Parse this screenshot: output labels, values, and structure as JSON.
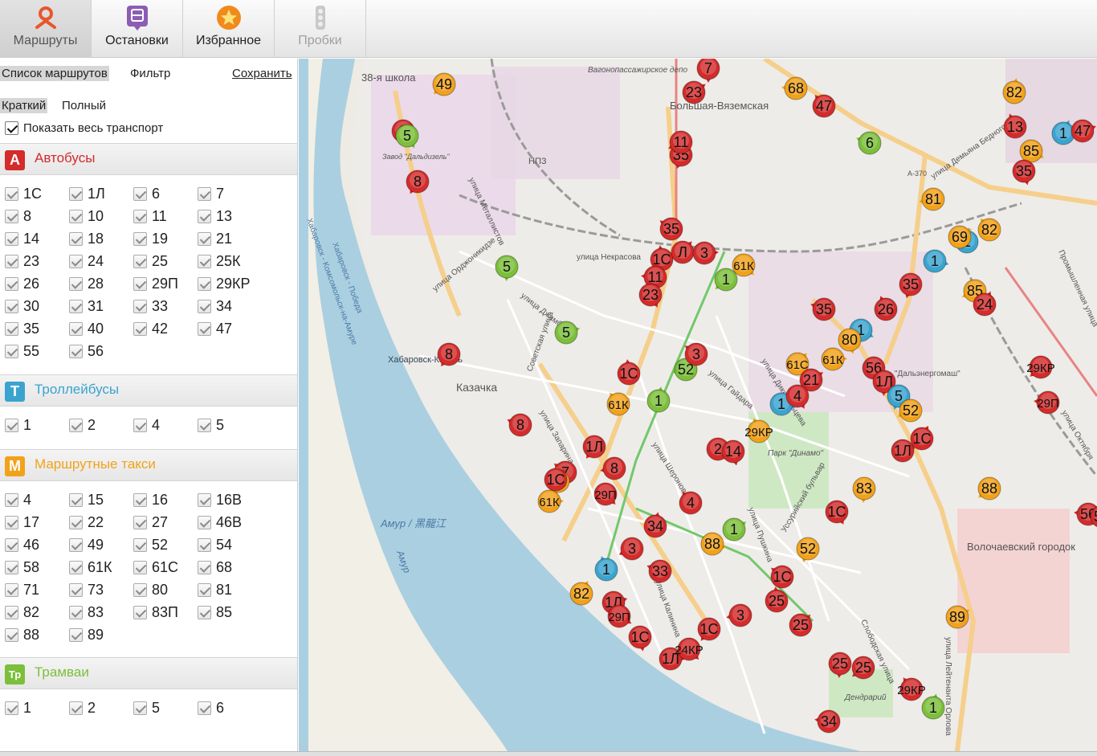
{
  "tabs": [
    {
      "label": "Маршруты",
      "icon": "route-pin-icon",
      "active": true
    },
    {
      "label": "Остановки",
      "icon": "bus-stop-icon"
    },
    {
      "label": "Избранное",
      "icon": "star-icon"
    },
    {
      "label": "Пробки",
      "icon": "traffic-light-icon",
      "disabled": true
    }
  ],
  "sidebar": {
    "list_tab": "Список маршрутов",
    "filter_tab": "Фильтр",
    "save_link": "Сохранить",
    "view_short": "Краткий",
    "view_full": "Полный",
    "show_all": "Показать весь транспорт"
  },
  "colors": {
    "bus": "#d42b2b",
    "trolleybus": "#3aa4cf",
    "minibus": "#f2a21a",
    "tram": "#7cbf3a"
  },
  "sections": [
    {
      "badge": "А",
      "title": "Автобусы",
      "color": "#d42b2b",
      "routes": [
        "1С",
        "1Л",
        "6",
        "7",
        "8",
        "10",
        "11",
        "13",
        "14",
        "18",
        "19",
        "21",
        "23",
        "24",
        "25",
        "25К",
        "26",
        "28",
        "29П",
        "29КР",
        "30",
        "31",
        "33",
        "34",
        "35",
        "40",
        "42",
        "47",
        "55",
        "56"
      ]
    },
    {
      "badge": "Т",
      "title": "Троллейбусы",
      "color": "#3aa4cf",
      "routes": [
        "1",
        "2",
        "4",
        "5"
      ]
    },
    {
      "badge": "М",
      "title": "Маршрутные такси",
      "color": "#f2a21a",
      "routes": [
        "4",
        "15",
        "16",
        "16В",
        "17",
        "22",
        "27",
        "46В",
        "46",
        "49",
        "52",
        "54",
        "58",
        "61К",
        "61С",
        "68",
        "71",
        "73",
        "80",
        "81",
        "82",
        "83",
        "83П",
        "85",
        "88",
        "89"
      ]
    },
    {
      "badge": "Тр",
      "title": "Трамваи",
      "color": "#7cbf3a",
      "routes": [
        "1",
        "2",
        "5",
        "6"
      ]
    }
  ],
  "map": {
    "labels": [
      "38-я школа",
      "Вагонопассажирское депо",
      "Большая-Вяземская",
      "НПЗ",
      "Завод \"Дальдизель\"",
      "улица Металлистов",
      "улица Некрасова",
      "улица Орджоникидзе",
      "улица Джамбула",
      "Хабаровск-Казань",
      "Казачка",
      "Советская улица",
      "улица Запарина",
      "улица Калинина",
      "улица Шеронова",
      "улица Гайдара",
      "улица Дикопольцева",
      "улица Пушкина",
      "Уссурийский бульвар",
      "Парк \"Динамо\"",
      "\"Дальэнергомаш\"",
      "Амур / 黑龍江",
      "Амур",
      "Волочаевский городок",
      "Дендрарий",
      "Слободская улица",
      "улица Лейтенанта Орлова",
      "улица Демьяна Бедного",
      "Промышленная улица",
      "улица Октября",
      "А-370",
      "Хабаровск - Комсомольск-на-Амуре",
      "Хабаровск - Победа"
    ],
    "markers": [
      {
        "t": "bus",
        "n": "7"
      },
      {
        "t": "minibus",
        "n": "49"
      },
      {
        "t": "minibus",
        "n": "68"
      },
      {
        "t": "bus",
        "n": "47"
      },
      {
        "t": "minibus",
        "n": "82"
      },
      {
        "t": "bus",
        "n": "23"
      },
      {
        "t": "bus",
        "n": "8"
      },
      {
        "t": "tram",
        "n": "5"
      },
      {
        "t": "bus",
        "n": "35"
      },
      {
        "t": "bus",
        "n": "11"
      },
      {
        "t": "tram",
        "n": "6"
      },
      {
        "t": "bus",
        "n": "13"
      },
      {
        "t": "trolleybus",
        "n": "1"
      },
      {
        "t": "bus",
        "n": "47"
      },
      {
        "t": "minibus",
        "n": "85"
      },
      {
        "t": "bus",
        "n": "35"
      },
      {
        "t": "bus",
        "n": "8"
      },
      {
        "t": "minibus",
        "n": "81"
      },
      {
        "t": "bus",
        "n": "35"
      },
      {
        "t": "bus",
        "n": "1С"
      },
      {
        "t": "bus",
        "n": "Л"
      },
      {
        "t": "bus",
        "n": "3"
      },
      {
        "t": "minibus",
        "n": "61К"
      },
      {
        "t": "tram",
        "n": "5"
      },
      {
        "t": "tram",
        "n": "1"
      },
      {
        "t": "bus",
        "n": "11"
      },
      {
        "t": "minibus",
        "n": "82"
      },
      {
        "t": "trolleybus",
        "n": "1"
      },
      {
        "t": "minibus",
        "n": "69"
      },
      {
        "t": "trolleybus",
        "n": "1"
      },
      {
        "t": "bus",
        "n": "23"
      },
      {
        "t": "bus",
        "n": "35"
      },
      {
        "t": "minibus",
        "n": "85"
      },
      {
        "t": "bus",
        "n": "35"
      },
      {
        "t": "bus",
        "n": "26"
      },
      {
        "t": "bus",
        "n": "24"
      },
      {
        "t": "tram",
        "n": "5"
      },
      {
        "t": "trolleybus",
        "n": "1"
      },
      {
        "t": "minibus",
        "n": "80"
      },
      {
        "t": "bus",
        "n": "8"
      },
      {
        "t": "tram",
        "n": "52"
      },
      {
        "t": "bus",
        "n": "3"
      },
      {
        "t": "bus",
        "n": "1С"
      },
      {
        "t": "minibus",
        "n": "61С"
      },
      {
        "t": "minibus",
        "n": "61К"
      },
      {
        "t": "bus",
        "n": "56"
      },
      {
        "t": "bus",
        "n": "1Л"
      },
      {
        "t": "bus",
        "n": "29КР"
      },
      {
        "t": "bus",
        "n": "29П"
      },
      {
        "t": "minibus",
        "n": "61К"
      },
      {
        "t": "tram",
        "n": "1"
      },
      {
        "t": "bus",
        "n": "21"
      },
      {
        "t": "trolleybus",
        "n": "1"
      },
      {
        "t": "bus",
        "n": "4"
      },
      {
        "t": "trolleybus",
        "n": "5"
      },
      {
        "t": "minibus",
        "n": "52"
      },
      {
        "t": "bus",
        "n": "8"
      },
      {
        "t": "minibus",
        "n": "29КР"
      },
      {
        "t": "bus",
        "n": "1С"
      },
      {
        "t": "bus",
        "n": "1Л"
      },
      {
        "t": "bus",
        "n": "2"
      },
      {
        "t": "bus",
        "n": "14"
      },
      {
        "t": "bus",
        "n": "1Л"
      },
      {
        "t": "bus",
        "n": "8"
      },
      {
        "t": "bus",
        "n": "7"
      },
      {
        "t": "minibus",
        "n": "82"
      },
      {
        "t": "bus",
        "n": "1С"
      },
      {
        "t": "minibus",
        "n": "61К"
      },
      {
        "t": "bus",
        "n": "29П"
      },
      {
        "t": "minibus",
        "n": "83"
      },
      {
        "t": "minibus",
        "n": "88"
      },
      {
        "t": "bus",
        "n": "56"
      },
      {
        "t": "bus",
        "n": "4"
      },
      {
        "t": "bus",
        "n": "34"
      },
      {
        "t": "tram",
        "n": "1"
      },
      {
        "t": "minibus",
        "n": "88"
      },
      {
        "t": "bus",
        "n": "1С"
      },
      {
        "t": "minibus",
        "n": "52"
      },
      {
        "t": "bus",
        "n": "3"
      },
      {
        "t": "bus",
        "n": "33"
      },
      {
        "t": "trolleybus",
        "n": "1"
      },
      {
        "t": "minibus",
        "n": "82"
      },
      {
        "t": "bus",
        "n": "1Л"
      },
      {
        "t": "bus",
        "n": "29П"
      },
      {
        "t": "bus",
        "n": "1С"
      },
      {
        "t": "bus",
        "n": "1С"
      },
      {
        "t": "bus",
        "n": "3"
      },
      {
        "t": "bus",
        "n": "1С"
      },
      {
        "t": "bus",
        "n": "25"
      },
      {
        "t": "bus",
        "n": "25"
      },
      {
        "t": "bus",
        "n": "1Л"
      },
      {
        "t": "bus",
        "n": "24КР"
      },
      {
        "t": "bus",
        "n": "25"
      },
      {
        "t": "bus",
        "n": "25"
      },
      {
        "t": "bus",
        "n": "34"
      },
      {
        "t": "bus",
        "n": "29КР"
      },
      {
        "t": "tram",
        "n": "1"
      },
      {
        "t": "minibus",
        "n": "89"
      },
      {
        "t": "bus",
        "n": "56"
      }
    ]
  }
}
